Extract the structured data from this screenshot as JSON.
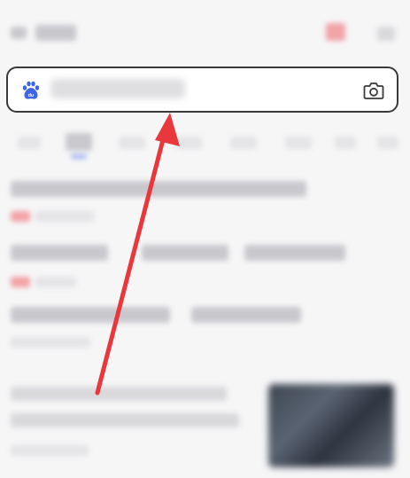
{
  "search": {
    "query": "",
    "logo_icon": "baidu-paw-icon",
    "camera_icon": "camera-icon"
  },
  "annotation": {
    "arrow_color": "#e8383d",
    "arrow_target": "search-box"
  },
  "colors": {
    "background": "#f6f6f7",
    "search_border": "#3a3a3c",
    "logo_blue": "#3d63e6"
  }
}
